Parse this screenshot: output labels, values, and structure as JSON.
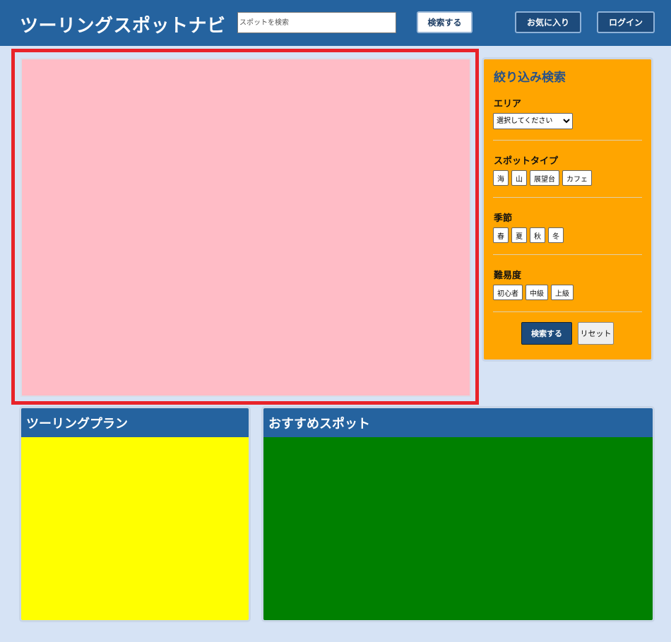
{
  "header": {
    "title": "ツーリングスポットナビ",
    "search_placeholder": "スポットを検索",
    "search_value": "",
    "search_button": "検索する",
    "favorites_button": "お気に入り",
    "login_button": "ログイン"
  },
  "filter": {
    "title": "絞り込み検索",
    "area": {
      "label": "エリア",
      "selected": "選択してください"
    },
    "spot_type": {
      "label": "スポットタイプ",
      "options": [
        "海",
        "山",
        "展望台",
        "カフェ"
      ]
    },
    "season": {
      "label": "季節",
      "options": [
        "春",
        "夏",
        "秋",
        "冬"
      ]
    },
    "difficulty": {
      "label": "難易度",
      "options": [
        "初心者",
        "中級",
        "上級"
      ]
    },
    "apply_button": "検索する",
    "reset_button": "リセット"
  },
  "plan_card": {
    "title": "ツーリングプラン"
  },
  "spots_card": {
    "title": "おすすめスポット"
  },
  "colors": {
    "header": "#25639f",
    "background": "#d6e3f5",
    "map_area": "#ffbcc6",
    "map_highlight_border": "#e8232a",
    "filter_panel": "#ffa500",
    "plan_body": "#ffff00",
    "spots_body": "#008000"
  }
}
